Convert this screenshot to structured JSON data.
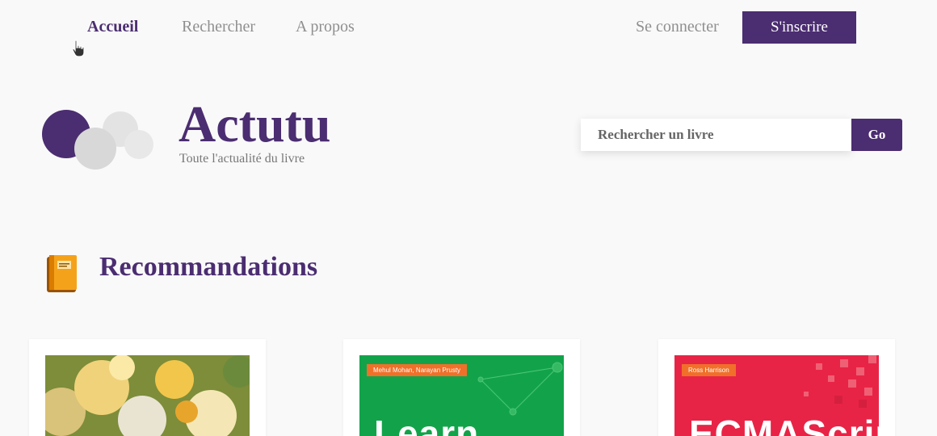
{
  "nav": {
    "links": [
      {
        "label": "Accueil",
        "active": true
      },
      {
        "label": "Rechercher",
        "active": false
      },
      {
        "label": "A propos",
        "active": false
      }
    ],
    "login_label": "Se connecter",
    "signup_label": "S'inscrire"
  },
  "header": {
    "brand": "Actutu",
    "tagline": "Toute l'actualité du livre"
  },
  "search": {
    "placeholder": "Rechercher un livre",
    "button_label": "Go"
  },
  "recommendations": {
    "title": "Recommandations",
    "icon": "orange-book-icon",
    "books": [
      {
        "cover_style": "flowers",
        "author_text": "",
        "cover_text": ""
      },
      {
        "cover_style": "green-network",
        "author_text": "Mehul Mohan, Narayan Prusty",
        "cover_text": "Learn"
      },
      {
        "cover_style": "red-pixels",
        "author_text": "Ross Harrison",
        "cover_text": "ECMAScript"
      }
    ]
  },
  "colors": {
    "accent": "#4b2d71",
    "background": "#f9f9f9",
    "muted_text": "#8f8f8f",
    "green_cover": "#12a34a",
    "red_cover": "#e82446",
    "orange_bar": "#f0702a"
  }
}
